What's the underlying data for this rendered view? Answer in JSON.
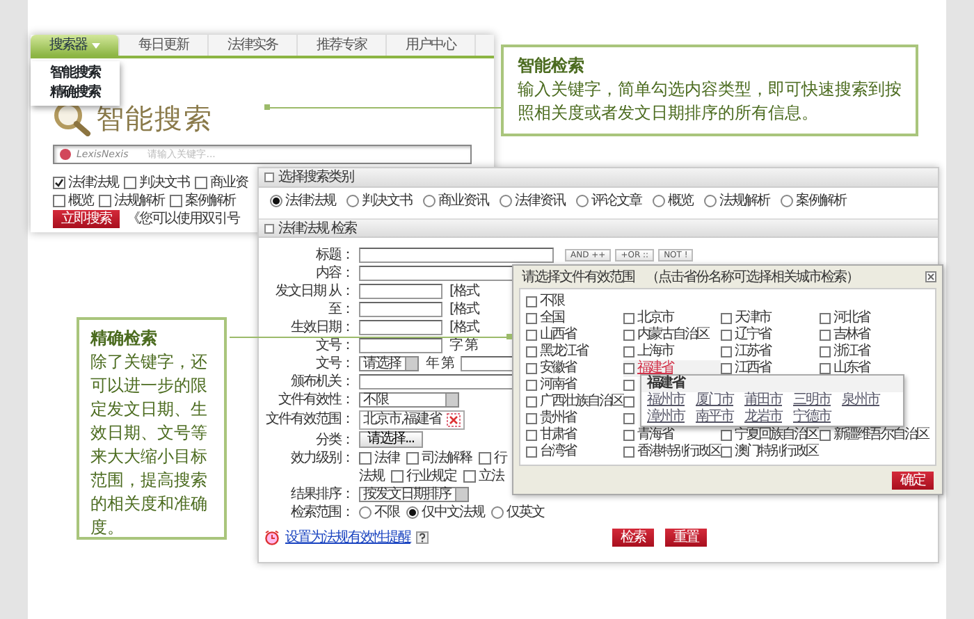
{
  "intro_screenshot": {
    "tabs": [
      {
        "label": "搜索器",
        "selected": true
      },
      {
        "label": "每日更新",
        "selected": false
      },
      {
        "label": "法律实务",
        "selected": false
      },
      {
        "label": "推荐专家",
        "selected": false
      },
      {
        "label": "用户中心",
        "selected": false
      }
    ],
    "dropdown": [
      "智能搜索",
      "精确搜索"
    ],
    "heading": "智能搜索",
    "search": {
      "brand": "LexisNexis",
      "placeholder": "请输入关键字..."
    },
    "categories": [
      [
        {
          "label": "法律法规",
          "checked": true
        },
        {
          "label": "判决文书",
          "checked": false
        },
        {
          "label": "商业资",
          "checked": false
        }
      ],
      [
        {
          "label": "概览",
          "checked": false
        },
        {
          "label": "法规解析",
          "checked": false
        },
        {
          "label": "案例解析",
          "checked": false
        }
      ]
    ],
    "search_button": "立即搜索",
    "hint": "《您可以使用双引号"
  },
  "category_panel": {
    "title": "选择搜索类别",
    "options": [
      {
        "label": "法律法规",
        "selected": true
      },
      {
        "label": "判决文书",
        "selected": false
      },
      {
        "label": "商业资讯",
        "selected": false
      },
      {
        "label": "法律资讯",
        "selected": false
      },
      {
        "label": "评论文章",
        "selected": false
      },
      {
        "label": "概览",
        "selected": false
      },
      {
        "label": "法规解析",
        "selected": false
      },
      {
        "label": "案例解析",
        "selected": false
      }
    ]
  },
  "search_panel": {
    "title": "法律法规 检索",
    "operators": [
      "AND ++",
      "+OR ::",
      "NOT !"
    ],
    "fields": [
      {
        "kind": "keyword",
        "label": "标题："
      },
      {
        "kind": "input",
        "label": "内容："
      },
      {
        "kind": "input",
        "label": "发文日期 从：",
        "suffix": "[格式"
      },
      {
        "kind": "input",
        "label": "至：",
        "suffix": "[格式"
      },
      {
        "kind": "input",
        "label": "生效日期：",
        "suffix": "[格式"
      },
      {
        "kind": "input",
        "label": "文号：",
        "suffix": "字 第"
      },
      {
        "kind": "select_input",
        "label": "文号：",
        "value": "请选择",
        "suffix": "年 第"
      },
      {
        "kind": "input",
        "label": "颁布机关："
      },
      {
        "kind": "select",
        "label": "文件有效性：",
        "value": "不限"
      },
      {
        "kind": "region",
        "label": "文件有效范围：",
        "value": "北京市,福建省"
      },
      {
        "kind": "button",
        "label": "分类：",
        "value": "请选择..."
      },
      {
        "kind": "checks",
        "label": "效力级别：",
        "options": [
          {
            "label": "法律",
            "checked": false
          },
          {
            "label": "司法解释",
            "checked": false
          },
          {
            "label": "行",
            "checked": false
          }
        ]
      },
      {
        "kind": "checks",
        "lead": "法规",
        "options": [
          {
            "label": "行业规定",
            "checked": false
          },
          {
            "label": "立法",
            "checked": false
          }
        ]
      },
      {
        "kind": "select",
        "label": "结果排序：",
        "value": "按发文日期排序"
      },
      {
        "kind": "radios",
        "label": "检索范围：",
        "options": [
          {
            "label": "不限",
            "selected": false
          },
          {
            "label": "仅中文法规",
            "selected": true
          },
          {
            "label": "仅英文",
            "selected": false
          }
        ]
      }
    ],
    "reminder_link": "设置为法规有效性提醒",
    "buttons": [
      "检索",
      "重置"
    ]
  },
  "region_dialog": {
    "title": "请选择文件有效范围",
    "hint": "（点击省份名称可选择相关城市检索）",
    "rows": [
      [
        {
          "label": "不限",
          "checked": false,
          "highlighted": false
        }
      ],
      [
        {
          "label": "全国",
          "checked": false,
          "highlighted": false
        },
        {
          "label": "北京市",
          "checked": false,
          "highlighted": false
        },
        {
          "label": "天津市",
          "checked": false,
          "highlighted": false
        },
        {
          "label": "河北省",
          "checked": false,
          "highlighted": false
        }
      ],
      [
        {
          "label": "山西省",
          "checked": false,
          "highlighted": false
        },
        {
          "label": "内蒙古自治区",
          "checked": false,
          "highlighted": false
        },
        {
          "label": "辽宁省",
          "checked": false,
          "highlighted": false
        },
        {
          "label": "吉林省",
          "checked": false,
          "highlighted": false
        }
      ],
      [
        {
          "label": "黑龙江省",
          "checked": false,
          "highlighted": false
        },
        {
          "label": "上海市",
          "checked": false,
          "highlighted": false
        },
        {
          "label": "江苏省",
          "checked": false,
          "highlighted": false
        },
        {
          "label": "浙江省",
          "checked": false,
          "highlighted": false
        }
      ],
      [
        {
          "label": "安徽省",
          "checked": false,
          "highlighted": false
        },
        {
          "label": "福建省",
          "checked": false,
          "highlighted": true
        },
        {
          "label": "江西省",
          "checked": false,
          "highlighted": false
        },
        {
          "label": "山东省",
          "checked": false,
          "highlighted": false
        }
      ],
      [
        {
          "label": "河南省",
          "checked": false,
          "highlighted": false
        },
        {
          "checked": false,
          "highlighted": false
        }
      ],
      [
        {
          "label": "广西壮族自治区",
          "checked": false,
          "highlighted": false
        },
        {
          "checked": false,
          "highlighted": false
        }
      ],
      [
        {
          "label": "贵州省",
          "checked": false,
          "highlighted": false
        },
        {
          "checked": false,
          "highlighted": false
        }
      ],
      [
        {
          "label": "甘肃省",
          "checked": false,
          "highlighted": false
        },
        {
          "label": "青海省",
          "checked": false,
          "highlighted": false
        },
        {
          "label": "宁夏回族自治区",
          "checked": false,
          "highlighted": false
        },
        {
          "label": "新疆维吾尔自治区",
          "checked": false,
          "highlighted": false
        }
      ],
      [
        {
          "label": "台湾省",
          "checked": false,
          "highlighted": false
        },
        {
          "label": "香港特别行政区",
          "checked": false,
          "highlighted": false
        },
        {
          "label": "澳门特别行政区",
          "checked": false,
          "highlighted": false
        }
      ]
    ],
    "popup": {
      "title": "福建省",
      "cities": [
        "福州市",
        "厦门市",
        "莆田市",
        "三明市",
        "泉州市",
        "漳州市",
        "南平市",
        "龙岩市",
        "宁德市"
      ]
    },
    "confirm": "确定"
  },
  "callouts": [
    {
      "title": "智能检索",
      "text": "输入关键字，简单勾选内容类型，即可快速搜索到按照相关度或者发文日期排序的所有信息。"
    },
    {
      "title": "精确检索",
      "text": "除了关键字，还可以进一步的限定发文日期、生效日期、文号等来大大缩小目标范围，提高搜索的相关度和准确度。"
    }
  ]
}
